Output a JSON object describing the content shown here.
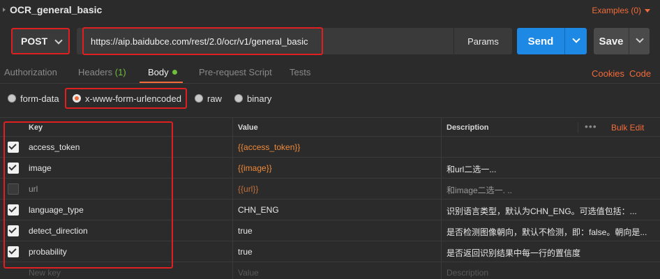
{
  "request": {
    "name": "OCR_general_basic",
    "examples_label": "Examples (0)",
    "method": "POST",
    "url": "https://aip.baidubce.com/rest/2.0/ocr/v1/general_basic",
    "params_label": "Params",
    "send_label": "Send",
    "save_label": "Save"
  },
  "tabs": {
    "authorization": "Authorization",
    "headers": "Headers",
    "headers_count": "(1)",
    "body": "Body",
    "prerequest": "Pre-request Script",
    "tests": "Tests",
    "cookies": "Cookies",
    "code": "Code"
  },
  "body_types": {
    "form_data": "form-data",
    "urlencoded": "x-www-form-urlencoded",
    "raw": "raw",
    "binary": "binary",
    "selected": "x-www-form-urlencoded"
  },
  "table": {
    "headers": {
      "key": "Key",
      "value": "Value",
      "description": "Description"
    },
    "more_icon": "•••",
    "bulk_edit": "Bulk Edit",
    "rows": [
      {
        "checked": true,
        "key": "access_token",
        "value": "{{access_token}}",
        "description": ""
      },
      {
        "checked": true,
        "key": "image",
        "value": "{{image}}",
        "description": "和url二选一..."
      },
      {
        "checked": false,
        "key": "url",
        "value": "{{url}}",
        "description": "和image二选一. .."
      },
      {
        "checked": true,
        "key": "language_type",
        "value": "CHN_ENG",
        "description": "识别语言类型，默认为CHN_ENG。可选值包括：..."
      },
      {
        "checked": true,
        "key": "detect_direction",
        "value": "true",
        "description": "是否检测图像朝向，默认不检测，即：false。朝向是..."
      },
      {
        "checked": true,
        "key": "probability",
        "value": "true",
        "description": "是否返回识别结果中每一行的置信度"
      }
    ],
    "placeholder": {
      "key": "New key",
      "value": "Value",
      "description": "Description"
    }
  },
  "colors": {
    "accent": "#f26b3a",
    "send_blue": "#1e88e5",
    "highlight_red": "#e02020",
    "status_green": "#6fbf3a"
  }
}
